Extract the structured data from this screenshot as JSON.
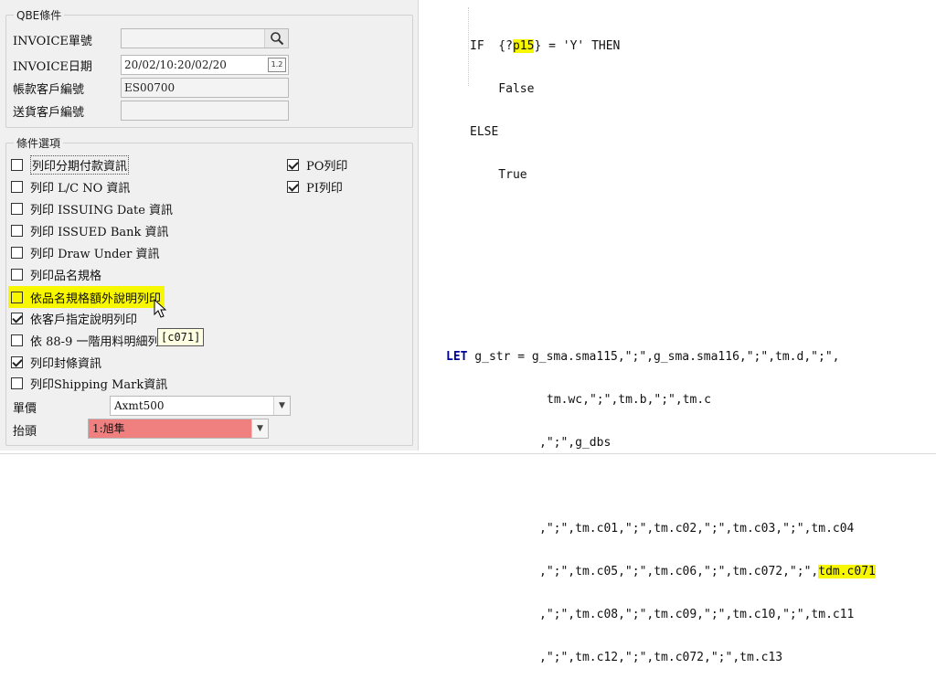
{
  "qbe": {
    "title": "QBE條件",
    "invoice_no_label": "INVOICE單號",
    "invoice_no_value": "",
    "invoice_date_label": "INVOICE日期",
    "invoice_date_value": "20/02/10:20/02/20",
    "account_customer_label": "帳款客戶編號",
    "account_customer_value": "ES00700",
    "ship_customer_label": "送貨客戶編號",
    "ship_customer_value": ""
  },
  "options": {
    "title": "條件選項",
    "items": [
      {
        "label": "列印分期付款資訊",
        "checked": false
      },
      {
        "label": "列印 L/C NO 資訊",
        "checked": false
      },
      {
        "label": "列印 ISSUING Date 資訊",
        "checked": false
      },
      {
        "label": "列印 ISSUED Bank 資訊",
        "checked": false
      },
      {
        "label": "列印 Draw Under 資訊",
        "checked": false
      },
      {
        "label": "列印品名規格",
        "checked": false
      },
      {
        "label": "依品名規格額外說明列印",
        "checked": false,
        "highlighted": true
      },
      {
        "label": "依客戶指定說明列印",
        "checked": true
      },
      {
        "label": "依 88-9 一階用料明細列",
        "checked": false
      },
      {
        "label": "列印封條資訊",
        "checked": true
      },
      {
        "label": "列印Shipping Mark資訊",
        "checked": false
      }
    ],
    "right_items": [
      {
        "label": "PO列印",
        "checked": true
      },
      {
        "label": "PI列印",
        "checked": true
      }
    ],
    "unit_price_label": "單價",
    "unit_price_value": "Axmt500",
    "header_label": "抬頭",
    "header_value": "1:旭隼"
  },
  "tooltip": "[c071]",
  "code_top": {
    "lines": [
      {
        "indent": "IF  {?",
        "hl": "p15",
        "rest": "} = 'Y' THEN"
      },
      {
        "indent": "    False",
        "hl": "",
        "rest": ""
      },
      {
        "indent": "ELSE",
        "hl": "",
        "rest": ""
      },
      {
        "indent": "    True",
        "hl": "",
        "rest": ""
      }
    ]
  },
  "code_bottom": {
    "let_kw": "LET",
    "line1": " g_str = g_sma.sma115,\";\",g_sma.sma116,\";\",tm.d,\";\",",
    "line2": "tm.wc,\";\",tm.b,\";\",tm.c",
    "line3": ",\";\",g_dbs",
    "line4": ",\";\",tm.c01,\";\",tm.c02,\";\",tm.c03,\";\",tm.c04",
    "line5": ",\";\",tm.c05,\";\",tm.c06,\";\",tm.c072,\";\",",
    "line5_hl": "tdm.c071",
    "line6": ",\";\",tm.c08,\";\",tm.c09,\";\",tm.c10,\";\",tm.c11",
    "line7": ",\";\",tm.c12,\";\",tm.c072,\";\",tm.c13"
  },
  "colors": {
    "highlight": "#f7f700",
    "header_select_bg": "#f08080"
  }
}
